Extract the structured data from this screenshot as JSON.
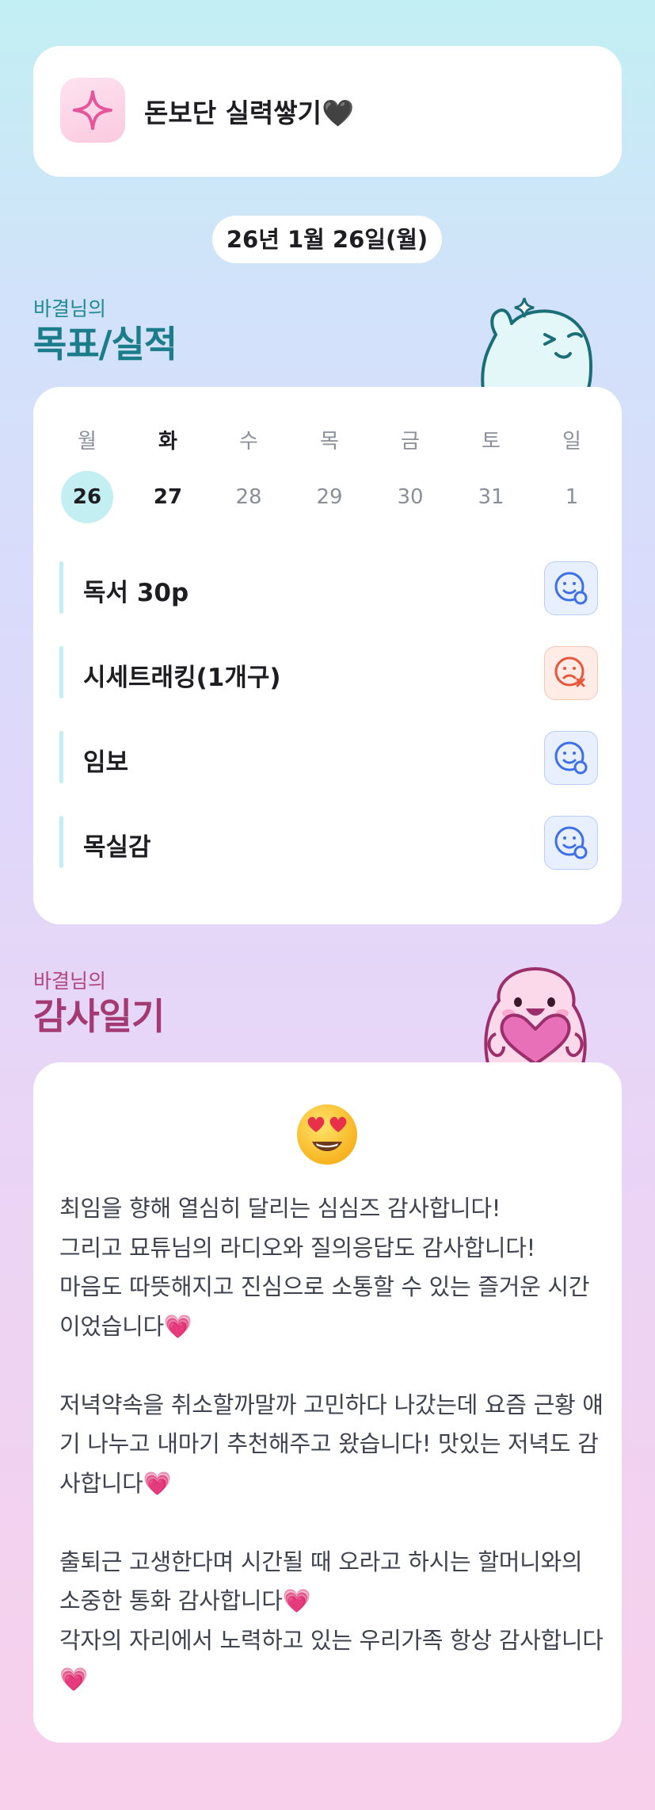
{
  "header": {
    "title": "돈보단 실력쌓기🖤",
    "icon": "sparkle-icon"
  },
  "date": "26년 1월 26일(월)",
  "goals_section": {
    "subtitle": "바결님의",
    "title": "목표/실적"
  },
  "week": [
    {
      "name": "월",
      "num": "26",
      "selected": true
    },
    {
      "name": "화",
      "num": "27",
      "today": true
    },
    {
      "name": "수",
      "num": "28"
    },
    {
      "name": "목",
      "num": "29"
    },
    {
      "name": "금",
      "num": "30"
    },
    {
      "name": "토",
      "num": "31"
    },
    {
      "name": "일",
      "num": "1"
    }
  ],
  "goals": [
    {
      "label": "독서 30p",
      "status": "done",
      "icon": "smile-check-icon"
    },
    {
      "label": "시세트래킹(1개구)",
      "status": "failed",
      "icon": "sad-x-icon"
    },
    {
      "label": "임보",
      "status": "done",
      "icon": "smile-check-icon"
    },
    {
      "label": "목실감",
      "status": "done",
      "icon": "smile-check-icon"
    }
  ],
  "diary_section": {
    "subtitle": "바결님의",
    "title": "감사일기"
  },
  "diary": {
    "mood_emoji": "😍",
    "text": "최임을 향해 열심히 달리는 심심즈 감사합니다!\n그리고 묘튜님의 라디오와 질의응답도 감사합니다!\n마음도 따뜻해지고 진심으로 소통할 수 있는 즐거운 시간이었습니다💗\n\n저녁약속을 취소할까말까 고민하다 나갔는데 요즘 근황 얘기 나누고 내마기 추천해주고 왔습니다! 맛있는 저녁도 감사합니다💗\n\n출퇴근 고생한다며 시간될 때 오라고 하시는 할머니와의 소중한 통화 감사합니다💗\n각자의 자리에서 노력하고 있는 우리가족 항상 감사합니다💗"
  },
  "colors": {
    "goal_accent": "#1a7d89",
    "diary_accent": "#a33a74",
    "selected_day": "#c3eef2",
    "ok_blue": "#3d6fe8",
    "fail_red": "#e8563a"
  }
}
